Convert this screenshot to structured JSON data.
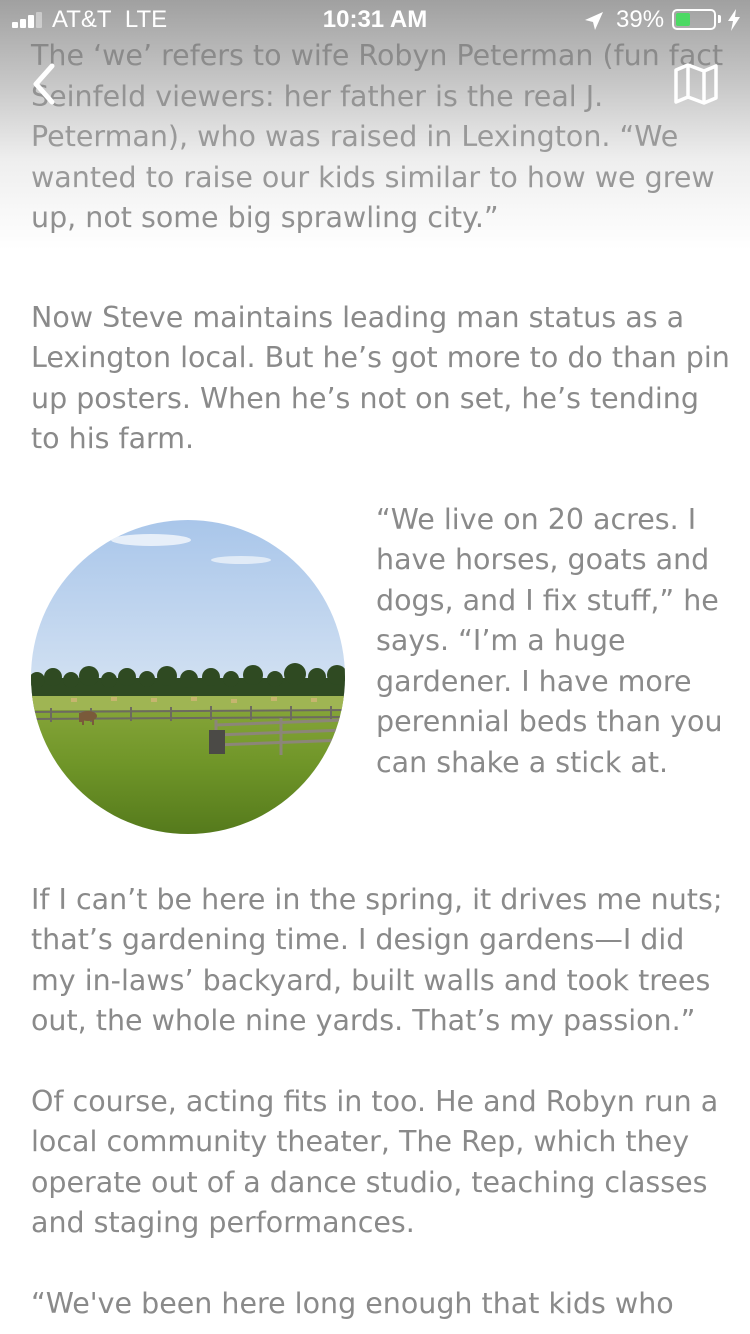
{
  "status_bar": {
    "carrier": "AT&T",
    "network": "LTE",
    "time": "10:31 AM",
    "battery_percent": "39%",
    "battery_level": 0.39,
    "signal_bars": 3,
    "signal_bars_total": 4,
    "battery_color": "#4cd964"
  },
  "header": {
    "back_icon": "chevron-left-icon",
    "map_icon": "map-icon"
  },
  "article": {
    "paragraphs": [
      "The ‘we’ refers to wife Robyn Peterman (fun fact Seinfeld viewers: her father is the real J. Peterman), who was raised in Lexington. “We wanted to raise our kids similar to how we grew up, not some big sprawling city.”",
      "Now Steve maintains leading man status as a Lexington local. But he’s got more to do than pin up posters. When he’s not on set, he’s tending to his farm.",
      "“We live on 20 acres. I have horses, goats and dogs, and I fix stuff,” he says. “I’m a huge gardener. I have more perennial beds than you can shake a stick at.",
      "If I can’t be here in the spring, it drives me nuts; that’s gardening time. I design gardens—I did my in-laws’ backyard, built walls and took trees out, the whole nine yards. That’s my passion.”",
      "Of course, acting fits in too. He and Robyn run a local community theater, The Rep, which they operate out of a dance studio, teaching classes and staging performances.",
      "“We've been here long enough that kids who"
    ],
    "text_color": "#8a8a8a"
  }
}
